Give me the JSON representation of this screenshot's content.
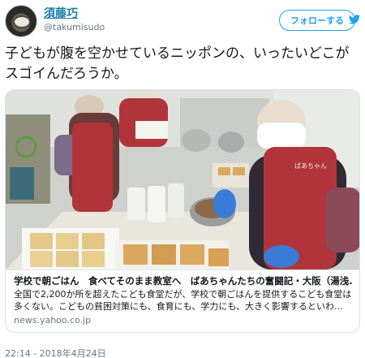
{
  "user": {
    "display_name": "須藤巧",
    "handle": "@takumisudo"
  },
  "follow_button": {
    "label": "フォローする"
  },
  "tweet": {
    "text": "子どもが腹を空かせているニッポンの、いったいどこがスゴイんだろうか。",
    "timestamp": "22:14 - 2018年4月24日"
  },
  "card": {
    "title": "学校で朝ごはん　食べてそのまま教室へ　ばあちゃんたちの奮闘記・大阪（湯浅...",
    "description": "全国で2,200か所を超えたこども食堂だが、学校で朝ごはんを提供するこども食堂は多くない。こどもの貧困対策にも、食育にも、学力にも、大きく影響するといわ...",
    "domain": "news.yahoo.co.jp",
    "apron_text": "ばあちゃん"
  },
  "colors": {
    "link": "#1b7ea8",
    "follow": "#1da1f2",
    "apron": "#b0343a"
  }
}
